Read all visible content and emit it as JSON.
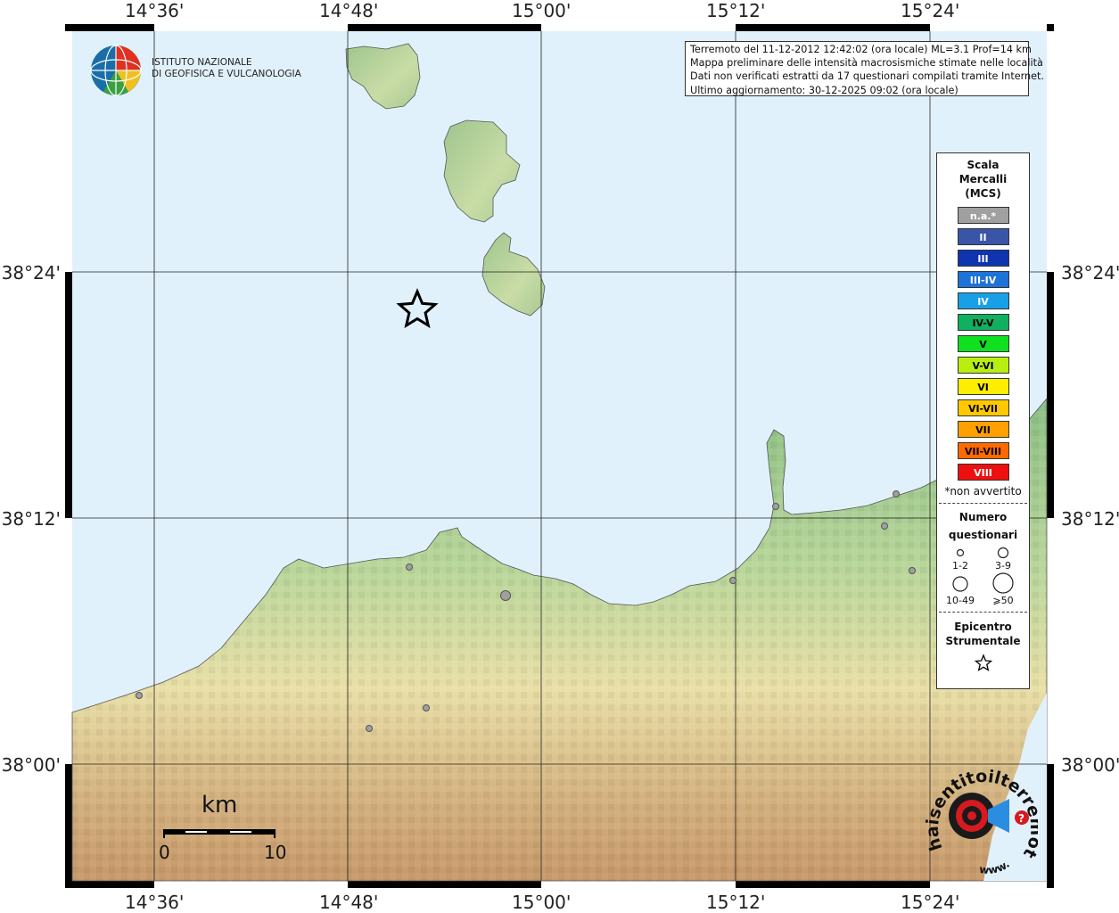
{
  "header": {
    "info_lines": [
      "Terremoto del 11-12-2012 12:42:02 (ora locale) ML=3.1 Prof=14 km",
      "Mappa preliminare delle intensità macrosismiche stimate nelle località",
      "Dati non verificati estratti da 17 questionari compilati tramite Internet.",
      "Ultimo aggiornamento: 30-12-2025 09:02 (ora locale)"
    ]
  },
  "institute": {
    "line1": "ISTITUTO NAZIONALE",
    "line2": "DI GEOFISICA E VULCANOLOGIA"
  },
  "axes": {
    "lon_labels": [
      "14°36'",
      "14°48'",
      "15°00'",
      "15°12'",
      "15°24'"
    ],
    "lat_labels": [
      "38°24'",
      "38°12'",
      "38°00'"
    ]
  },
  "legend": {
    "scale_title": [
      "Scala",
      "Mercalli",
      "(MCS)"
    ],
    "classes": [
      {
        "label": "n.a.*",
        "color": "#a0a0a0",
        "text_color": "#ffffff"
      },
      {
        "label": "II",
        "color": "#3a55a8",
        "text_color": "#ffffff"
      },
      {
        "label": "III",
        "color": "#1034b0",
        "text_color": "#ffffff"
      },
      {
        "label": "III-IV",
        "color": "#1e72d8",
        "text_color": "#ffffff"
      },
      {
        "label": "IV",
        "color": "#18a0e6",
        "text_color": "#ffffff"
      },
      {
        "label": "IV-V",
        "color": "#10b060",
        "text_color": "#000000"
      },
      {
        "label": "V",
        "color": "#10e020",
        "text_color": "#000000"
      },
      {
        "label": "V-VI",
        "color": "#b8ee10",
        "text_color": "#000000"
      },
      {
        "label": "VI",
        "color": "#ffee00",
        "text_color": "#000000"
      },
      {
        "label": "VI-VII",
        "color": "#ffc800",
        "text_color": "#000000"
      },
      {
        "label": "VII",
        "color": "#ffa000",
        "text_color": "#000000"
      },
      {
        "label": "VII-VIII",
        "color": "#ff6a00",
        "text_color": "#000000"
      },
      {
        "label": "VIII",
        "color": "#ee1010",
        "text_color": "#ffffff"
      }
    ],
    "not_felt_note": "*non avvertito",
    "count_title": [
      "Numero",
      "questionari"
    ],
    "count_classes": [
      "1-2",
      "3-9",
      "10-49",
      "⩾50"
    ],
    "epicenter_title": [
      "Epicentro",
      "Strumentale"
    ]
  },
  "scale_bar": {
    "unit": "km",
    "min_label": "0",
    "max_label": "10"
  },
  "brand": {
    "text": "haisentitoilterremoto.it",
    "url_text": "www."
  },
  "colors": {
    "sea": "#e1f1fb",
    "land_low": "#8cbf84",
    "land_mid": "#e9dfa7",
    "land_high": "#c6986a",
    "frame": "#000000"
  }
}
